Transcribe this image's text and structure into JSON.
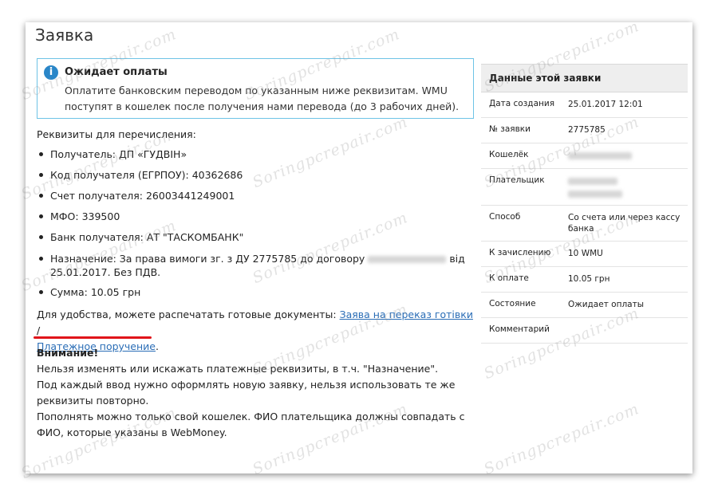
{
  "page": {
    "title": "Заявка"
  },
  "notice": {
    "icon": "info-icon",
    "title": "Ожидает оплаты",
    "text": "Оплатите банковским переводом по указанным ниже реквизитам. WMU поступят в кошелек после получения нами перевода (до 3 рабочих дней)."
  },
  "details": {
    "heading": "Реквизиты для перечисления:",
    "items": [
      "Получатель: ДП «ГУДВІН»",
      "Код получателя (ЕГРПОУ): 40362686",
      "Счет получателя: 26003441249001",
      "МФО: 339500",
      "Банк получателя: АТ \"ТАСКОМБАНК\"",
      "Назначение: За права вимоги зг. з ДУ 2775785 до договору",
      "від",
      "25.01.2017. Без ПДВ.",
      "Сумма: 10.05 грн"
    ]
  },
  "print": {
    "prefix": "Для удобства, можете распечатать готовые документы:",
    "link1": "Заява на переказ готівки",
    "sep": "/",
    "link2": "Платежное поручение",
    "suffix": "."
  },
  "warning": {
    "title": "Внимание!",
    "lines": [
      "Нельзя изменять или искажать платежные реквизиты, в т.ч. \"Назначение\".",
      "Под каждый ввод нужно оформлять новую заявку, нельзя использовать те же реквизиты повторно.",
      "Пополнять можно только свой кошелек. ФИО плательщика должны совпадать с ФИО, которые указаны в WebMoney."
    ]
  },
  "sidebar": {
    "title": "Данные этой заявки",
    "rows": [
      {
        "label": "Дата создания",
        "value": "25.01.2017 12:01"
      },
      {
        "label": "№ заявки",
        "value": "2775785"
      },
      {
        "label": "Кошелёк",
        "value": ""
      },
      {
        "label": "Плательщик",
        "value": ""
      },
      {
        "label": "Способ",
        "value": "Со счета или через кассу банка"
      },
      {
        "label": "К зачислению",
        "value": "10 WMU"
      },
      {
        "label": "К оплате",
        "value": "10.05 грн"
      },
      {
        "label": "Состояние",
        "value": "Ожидает оплаты"
      },
      {
        "label": "Комментарий",
        "value": ""
      }
    ]
  },
  "watermark": {
    "text": "Soringpcrepair.com"
  },
  "colors": {
    "link": "#2a6db6",
    "notice_border": "#6ec3e6",
    "info_icon": "#2a86c8",
    "annotation": "#e0141a"
  }
}
